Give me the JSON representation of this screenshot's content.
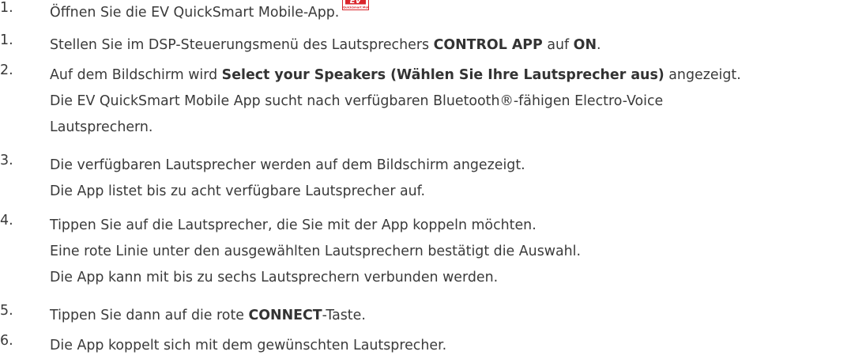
{
  "steps": [
    {
      "number": "1.",
      "lines": [
        [
          {
            "text": "Öffnen Sie die EV QuickSmart Mobile-App."
          }
        ]
      ],
      "app_logo": {
        "mark": "EV",
        "caption": "EV QuickSmart Mobile",
        "color": "#d9262c"
      }
    },
    {
      "number": "1.",
      "lines": [
        [
          {
            "text": "Stellen Sie im DSP-Steuerungsmenü des Lautsprechers "
          },
          {
            "text": "CONTROL APP",
            "bold": true
          },
          {
            "text": " auf "
          },
          {
            "text": "ON",
            "bold": true
          },
          {
            "text": "."
          }
        ]
      ]
    },
    {
      "number": "2.",
      "lines": [
        [
          {
            "text": "Auf dem Bildschirm wird "
          },
          {
            "text": "Select your Speakers (Wählen Sie Ihre Lautsprecher aus)",
            "bold": true
          },
          {
            "text": " angezeigt."
          }
        ],
        [
          {
            "text": "Die EV QuickSmart Mobile App sucht nach verfügbaren Bluetooth®-fähigen Electro-Voice"
          }
        ],
        [
          {
            "text": "Lautsprechern."
          }
        ]
      ]
    },
    {
      "number": "3.",
      "lines": [
        [
          {
            "text": "Die verfügbaren Lautsprecher werden auf dem Bildschirm angezeigt."
          }
        ],
        [
          {
            "text": "Die App listet bis zu acht verfügbare Lautsprecher auf."
          }
        ]
      ]
    },
    {
      "number": "4.",
      "lines": [
        [
          {
            "text": "Tippen Sie auf die Lautsprecher, die Sie mit der App koppeln möchten."
          }
        ],
        [
          {
            "text": "Eine rote Linie unter den ausgewählten Lautsprechern bestätigt die Auswahl."
          }
        ],
        [
          {
            "text": "Die App kann mit bis zu sechs Lautsprechern verbunden werden."
          }
        ]
      ]
    },
    {
      "number": "5.",
      "lines": [
        [
          {
            "text": "Tippen Sie dann auf die rote "
          },
          {
            "text": "CONNECT",
            "bold": true
          },
          {
            "text": "-Taste."
          }
        ]
      ]
    },
    {
      "number": "6.",
      "lines": [
        [
          {
            "text": "Die App koppelt sich mit dem gewünschten Lautsprecher."
          }
        ]
      ]
    }
  ]
}
